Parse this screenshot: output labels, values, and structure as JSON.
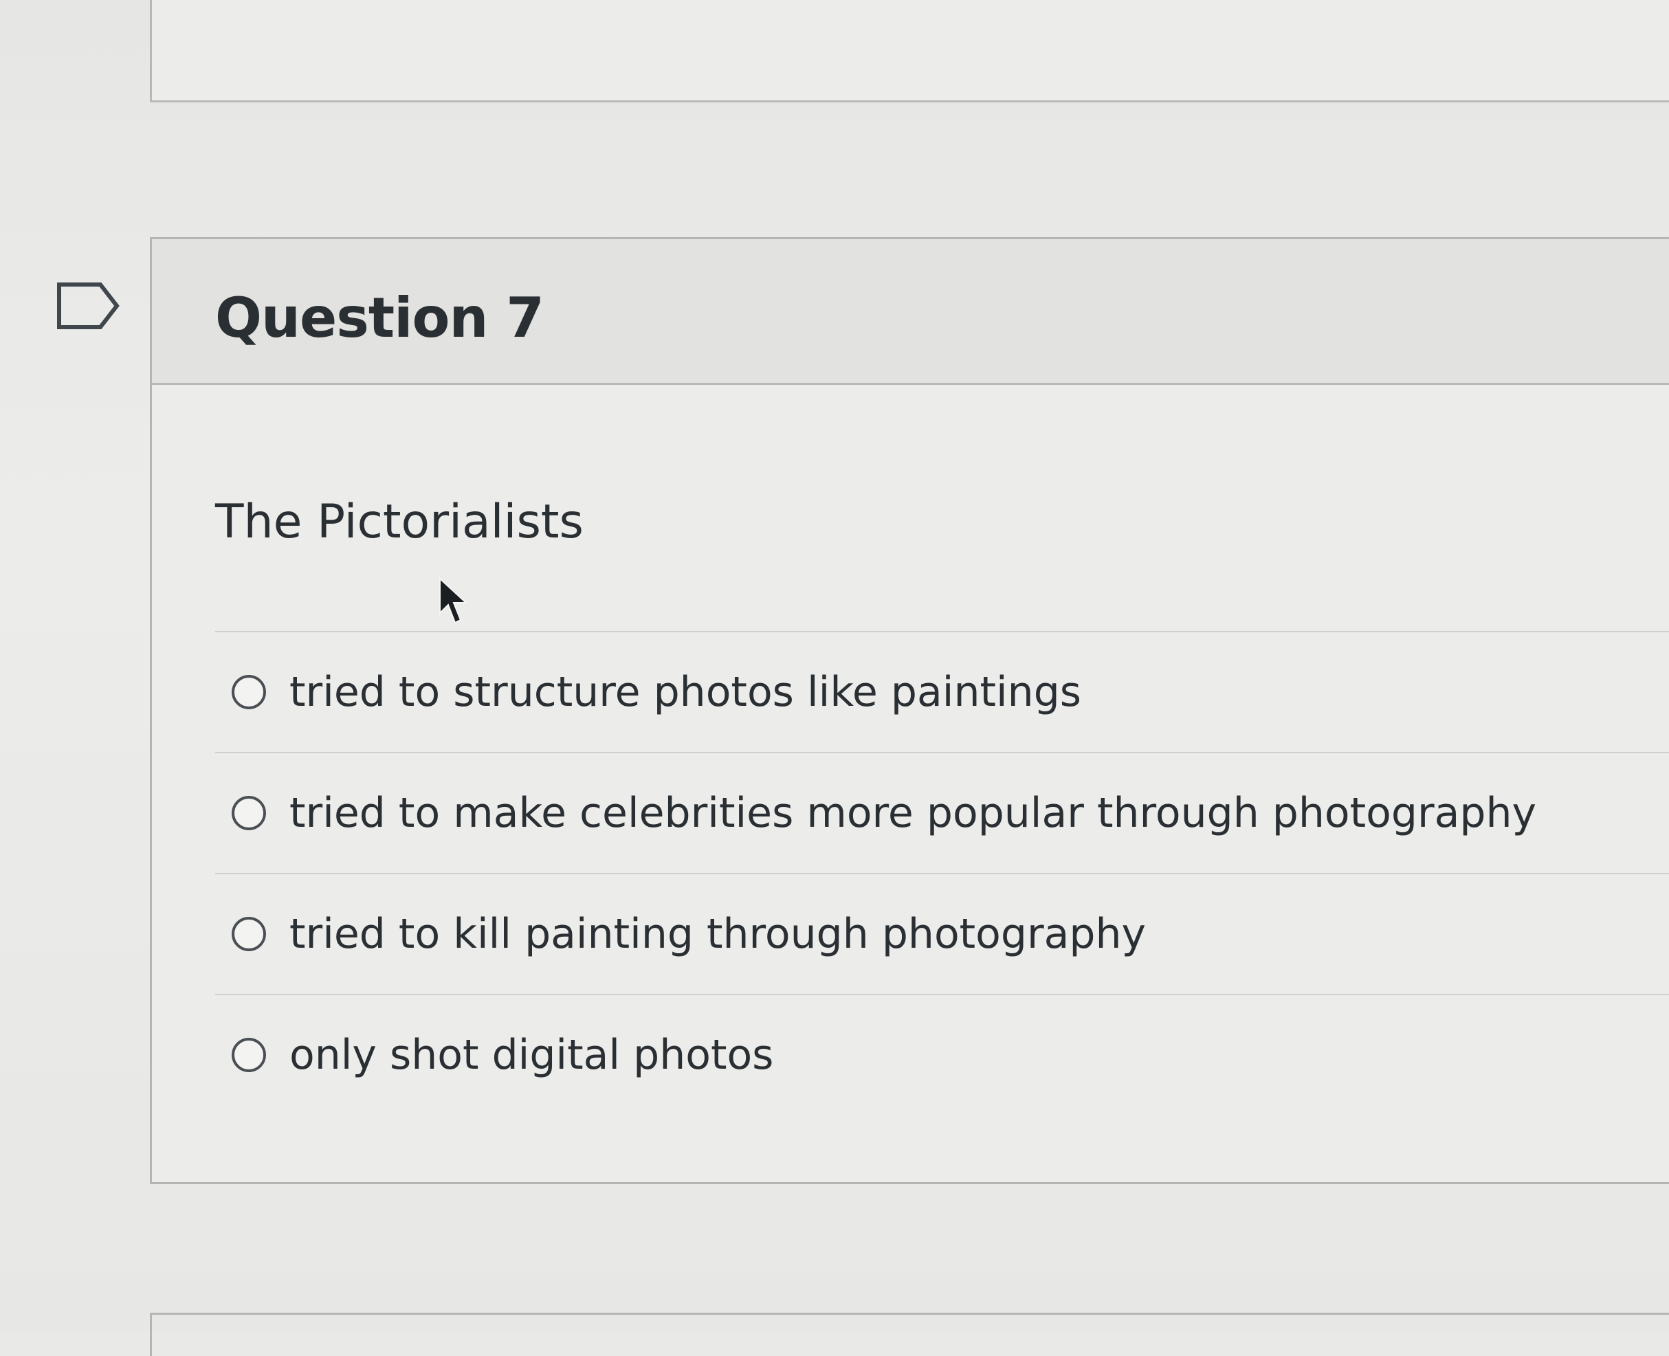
{
  "question": {
    "title": "Question 7",
    "prompt": "The Pictorialists",
    "answers": [
      {
        "label": "tried to structure photos like paintings",
        "selected": false
      },
      {
        "label": "tried to make celebrities more popular through photography",
        "selected": false
      },
      {
        "label": "tried to kill painting through photography",
        "selected": false
      },
      {
        "label": "only shot digital photos",
        "selected": false
      }
    ]
  },
  "colors": {
    "background": "#e9e9e8",
    "card_border": "#b5b5b3",
    "text": "#2a2f33"
  }
}
